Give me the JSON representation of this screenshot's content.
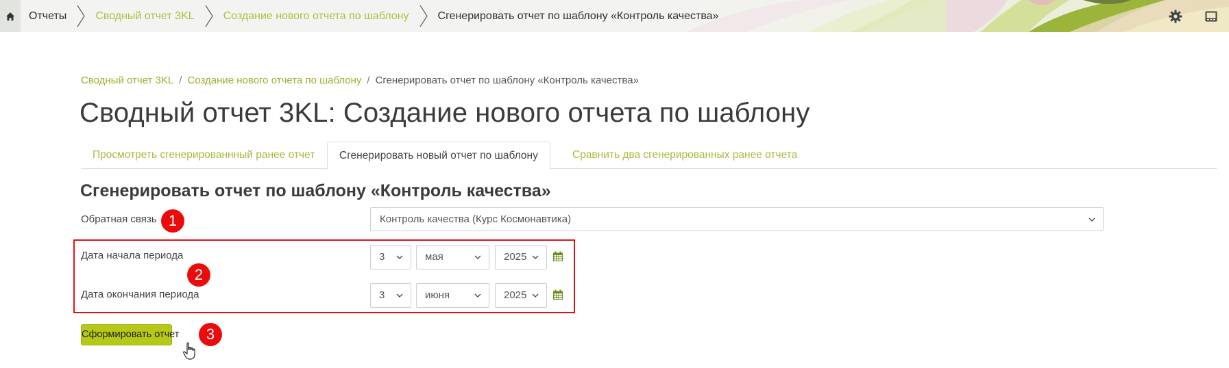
{
  "topbar": {
    "breadcrumbs": [
      {
        "label": "Отчеты",
        "link": false
      },
      {
        "label": "Сводный отчет 3KL",
        "link": true
      },
      {
        "label": "Создание нового отчета по шаблону",
        "link": true
      },
      {
        "label": "Сгенерировать отчет по шаблону «Контроль качества»",
        "link": false
      }
    ],
    "icons": [
      "home-icon",
      "gear-icon",
      "panel-icon"
    ]
  },
  "breadcrumb": {
    "items": [
      "Сводный отчет 3KL",
      "Создание нового отчета по шаблону",
      "Сгенерировать отчет по шаблону «Контроль качества»"
    ],
    "separator": "/"
  },
  "page_title": "Сводный отчет 3KL: Создание нового отчета по шаблону",
  "tabs": [
    {
      "label": "Просмотреть сгенерированнный ранее отчет",
      "active": false
    },
    {
      "label": "Сгенерировать новый отчет по шаблону",
      "active": true
    },
    {
      "label": "Сравнить два сгенерированных ранее отчета",
      "active": false
    }
  ],
  "form": {
    "title": "Сгенерировать отчет по шаблону «Контроль качества»",
    "feedback": {
      "label": "Обратная связь",
      "value": "Контроль качества (Курс Космонавтика)"
    },
    "start_date": {
      "label": "Дата начала периода",
      "day": "3",
      "month": "мая",
      "year": "2025"
    },
    "end_date": {
      "label": "Дата окончания периода",
      "day": "3",
      "month": "июня",
      "year": "2025"
    },
    "submit_label": "Сформировать отчет"
  },
  "annotations": [
    "1",
    "2",
    "3"
  ],
  "colors": {
    "accent_link": "#a9c23f",
    "button": "#b6c917",
    "annotation_red": "#ec0b0b",
    "calendar_green": "#6a8f1a"
  }
}
